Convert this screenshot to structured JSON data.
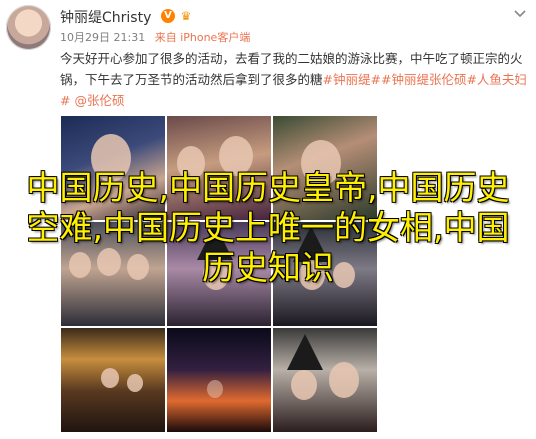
{
  "post": {
    "author": "钟丽缇Christy",
    "time": "10月29日 21:31",
    "source": "来自 iPhone客户端",
    "text_part1": "今天好开心参加了很多的活动，去看了我的二姑娘的游泳比赛，中午吃了顿正宗的火锅，下午去了万圣节的活动然后拿到了很多的糖",
    "tags": [
      "#钟丽缇#",
      "#钟丽缇张伦硕#",
      "人鱼夫妇#"
    ],
    "mention": "@张伦硕",
    "icons": {
      "verified": "verified-v-icon",
      "crown": "crown-icon",
      "menu": "chevron-down-icon"
    }
  },
  "overlay_text": "中国历史,中国历史皇帝,中国历史空难,中国历史上唯一的女相,中国历史知识",
  "colors": {
    "accent": "#eb7350",
    "overlay": "#ffef00"
  }
}
